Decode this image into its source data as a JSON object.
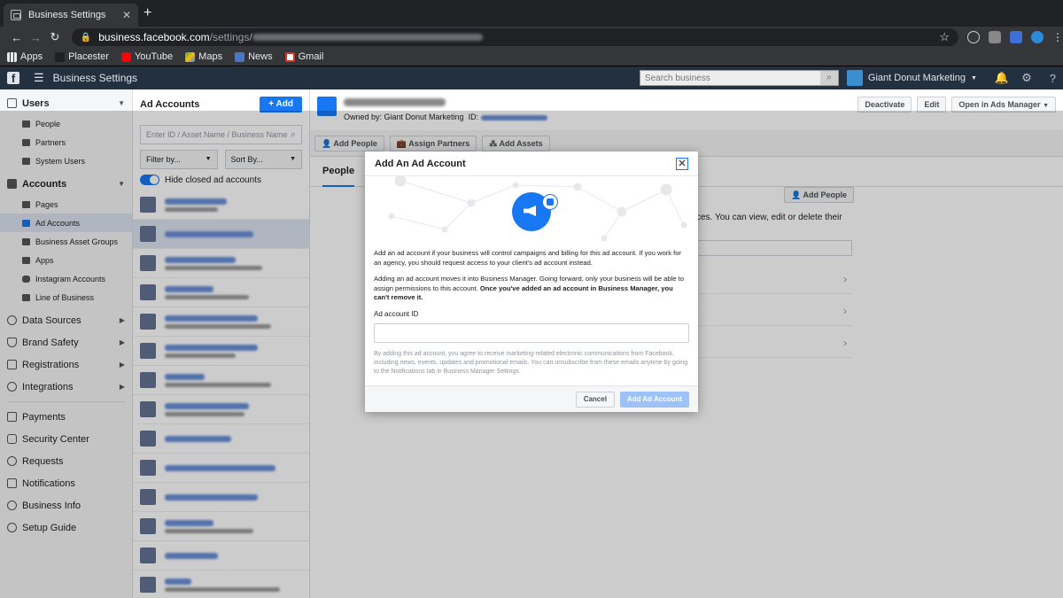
{
  "browser": {
    "tab_title": "Business Settings",
    "url_host": "business.facebook.com",
    "url_path": "/settings/",
    "bookmarks": [
      "Apps",
      "Placester",
      "YouTube",
      "Maps",
      "News",
      "Gmail"
    ]
  },
  "topbar": {
    "title": "Business Settings",
    "search_placeholder": "Search business",
    "business_name": "Giant Donut Marketing"
  },
  "sidebar": {
    "sections": [
      {
        "label": "Users",
        "items": [
          "People",
          "Partners",
          "System Users"
        ]
      },
      {
        "label": "Accounts",
        "items": [
          "Pages",
          "Ad Accounts",
          "Business Asset Groups",
          "Apps",
          "Instagram Accounts",
          "Line of Business"
        ]
      }
    ],
    "collapsed": [
      "Data Sources",
      "Brand Safety",
      "Registrations",
      "Integrations"
    ],
    "bottom": [
      "Payments",
      "Security Center",
      "Requests",
      "Notifications",
      "Business Info",
      "Setup Guide"
    ]
  },
  "list": {
    "title": "Ad Accounts",
    "add_label": "Add",
    "search_placeholder": "Enter ID / Asset Name / Business Name",
    "filter_label": "Filter by...",
    "sort_label": "Sort By...",
    "hide_closed_label": "Hide closed ad accounts"
  },
  "content": {
    "owned_by": "Owned by: Giant Donut Marketing",
    "id_label": "ID:",
    "deactivate": "Deactivate",
    "edit": "Edit",
    "open_ads_manager": "Open in Ads Manager",
    "add_people": "Add People",
    "assign_partners": "Assign Partners",
    "add_assets": "Add Assets",
    "tab_people": "People",
    "add_people_right": "Add People",
    "bg_text": "ces. You can view, edit or delete their"
  },
  "dialog": {
    "title": "Add An Ad Account",
    "para1": "Add an ad account if your business will control campaigns and billing for this ad account. If you work for an agency, you should request access to your client's ad account instead.",
    "para2_plain": "Adding an ad account moves it into Business Manager. Going forward, only your business will be able to assign permissions to this account. ",
    "para2_bold": "Once you've added an ad account in Business Manager, you can't remove it.",
    "field_label": "Ad account ID",
    "legal": "By adding this ad account, you agree to receive marketing-related electronic communications from Facebook, including news, events, updates and promotional emails. You can unsubscribe from these emails anytime by going to the Notifications tab in Business Manager Settings.",
    "cancel": "Cancel",
    "submit": "Add Ad Account"
  }
}
